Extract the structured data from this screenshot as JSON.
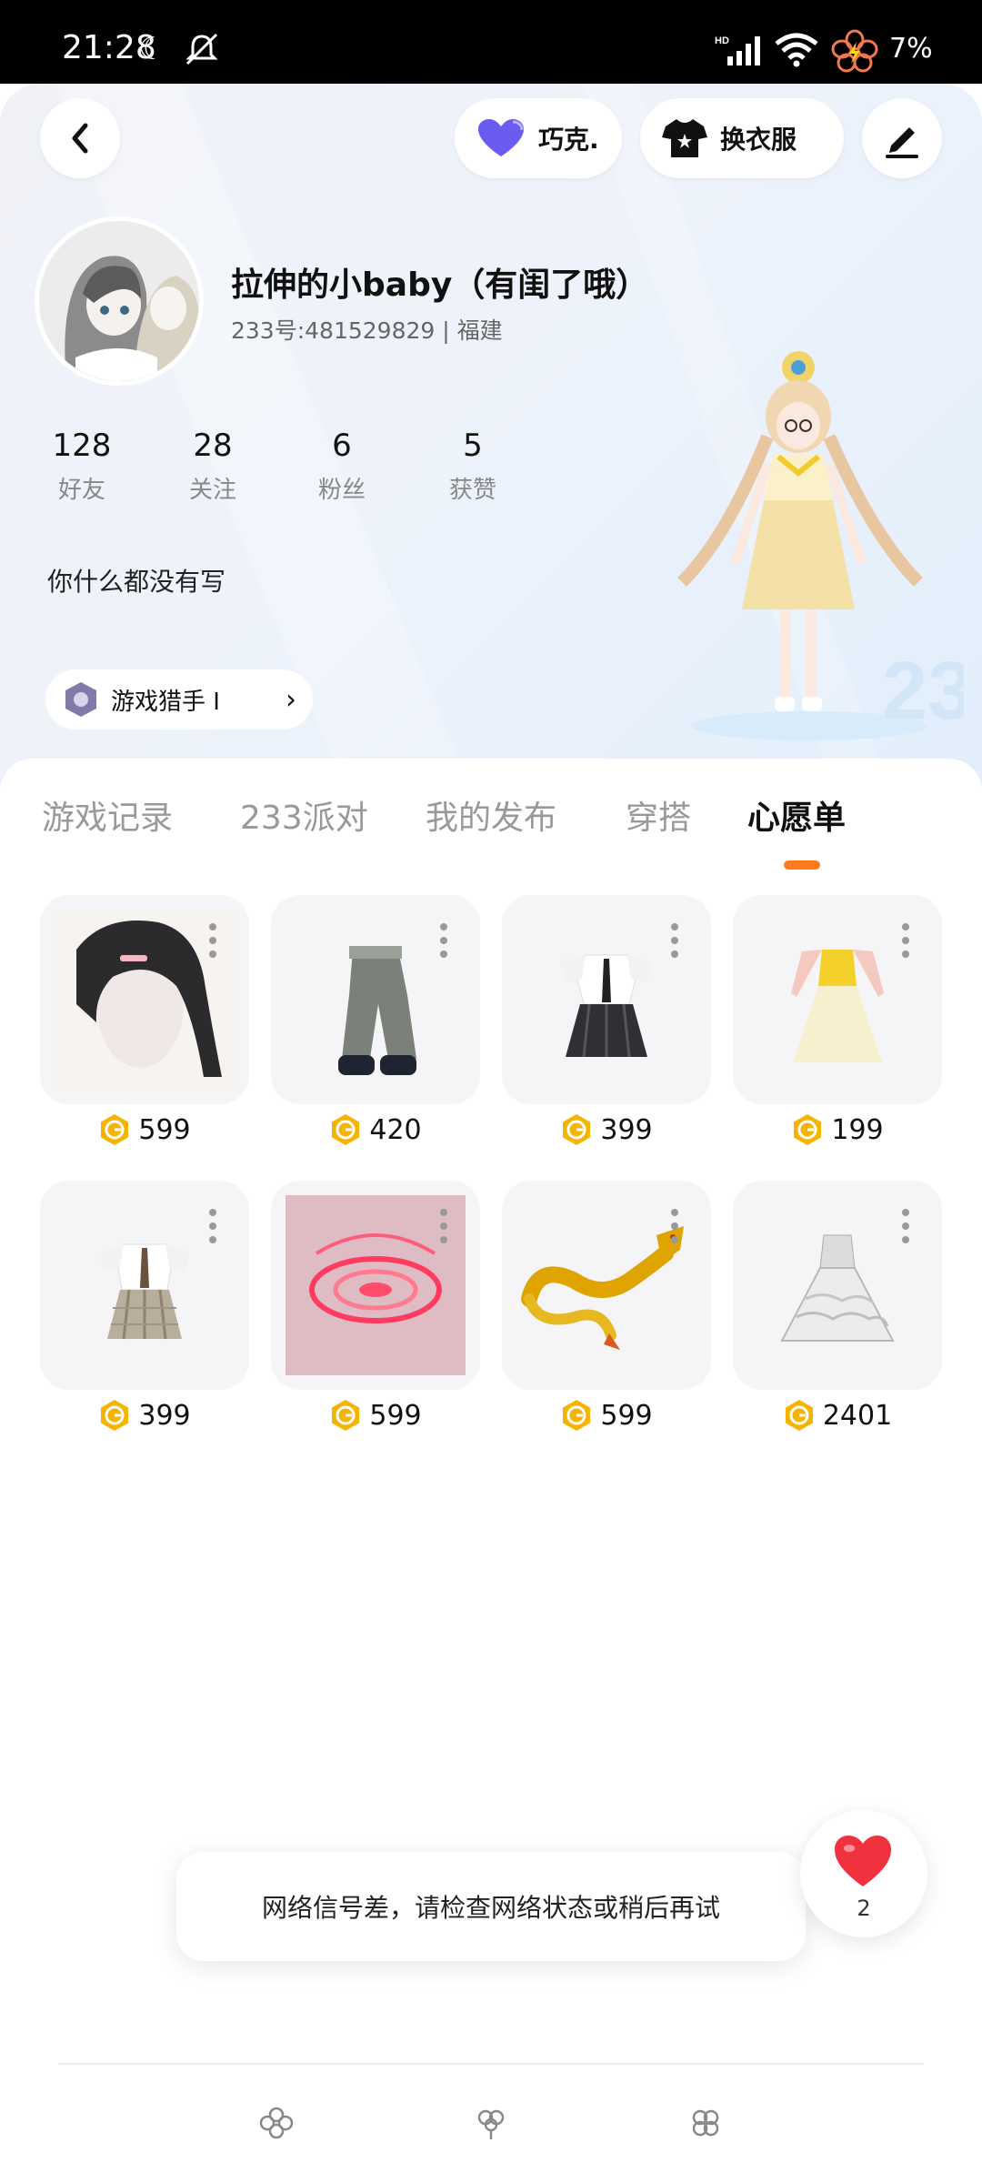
{
  "status_bar": {
    "time": "21:28",
    "battery": "7%"
  },
  "header": {
    "pet_label": "巧克.",
    "dress_label": "换衣服"
  },
  "profile": {
    "name": "拉伸的小baby（有闺了哦）",
    "id_line": "233号:481529829 | 福建",
    "bio": "你什么都没有写",
    "badge_label": "游戏猎手 I"
  },
  "stats": [
    {
      "value": "128",
      "label": "好友"
    },
    {
      "value": "28",
      "label": "关注"
    },
    {
      "value": "6",
      "label": "粉丝"
    },
    {
      "value": "5",
      "label": "获赞"
    }
  ],
  "tabs": [
    {
      "label": "游戏记录"
    },
    {
      "label": "233派对"
    },
    {
      "label": "我的发布"
    },
    {
      "label": "穿搭"
    },
    {
      "label": "心愿单"
    }
  ],
  "active_tab": "心愿单",
  "wishlist": [
    {
      "item": "hair",
      "price": "599"
    },
    {
      "item": "pants",
      "price": "420"
    },
    {
      "item": "uniform-dark",
      "price": "399"
    },
    {
      "item": "yellow-dress",
      "price": "199"
    },
    {
      "item": "uniform-plaid",
      "price": "399"
    },
    {
      "item": "glow-platform",
      "price": "599"
    },
    {
      "item": "golden-dragon",
      "price": "599"
    },
    {
      "item": "lace-gown",
      "price": "2401"
    }
  ],
  "toast": {
    "message": "网络信号差，请检查网络状态或稍后再试"
  },
  "like_fab": {
    "count": "2"
  },
  "colors": {
    "accent": "#ff7a1a",
    "coin": "#f5b400",
    "heart": "#f0323f",
    "pet_heart": "#6a5cf0"
  }
}
